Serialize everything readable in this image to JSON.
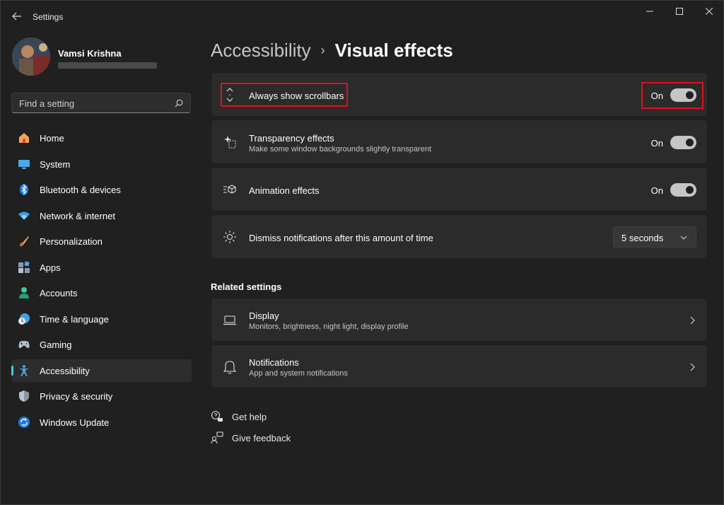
{
  "window": {
    "title": "Settings"
  },
  "profile": {
    "name": "Vamsi Krishna"
  },
  "search": {
    "placeholder": "Find a setting"
  },
  "sidebar": {
    "items": [
      {
        "label": "Home",
        "icon": "home-icon"
      },
      {
        "label": "System",
        "icon": "system-icon"
      },
      {
        "label": "Bluetooth & devices",
        "icon": "bluetooth-icon"
      },
      {
        "label": "Network & internet",
        "icon": "wifi-icon"
      },
      {
        "label": "Personalization",
        "icon": "brush-icon"
      },
      {
        "label": "Apps",
        "icon": "apps-icon"
      },
      {
        "label": "Accounts",
        "icon": "person-icon"
      },
      {
        "label": "Time & language",
        "icon": "globe-clock-icon"
      },
      {
        "label": "Gaming",
        "icon": "gamepad-icon"
      },
      {
        "label": "Accessibility",
        "icon": "accessibility-icon",
        "active": true
      },
      {
        "label": "Privacy & security",
        "icon": "shield-icon"
      },
      {
        "label": "Windows Update",
        "icon": "refresh-icon"
      }
    ]
  },
  "breadcrumb": {
    "parent": "Accessibility",
    "separator": "›",
    "current": "Visual effects"
  },
  "settings": {
    "scrollbars": {
      "title": "Always show scrollbars",
      "state_label": "On"
    },
    "transparency": {
      "title": "Transparency effects",
      "subtitle": "Make some window backgrounds slightly transparent",
      "state_label": "On"
    },
    "animation": {
      "title": "Animation effects",
      "state_label": "On"
    },
    "notifications_timeout": {
      "title": "Dismiss notifications after this amount of time",
      "value": "5 seconds"
    }
  },
  "related": {
    "title": "Related settings",
    "display": {
      "title": "Display",
      "subtitle": "Monitors, brightness, night light, display profile"
    },
    "notifications": {
      "title": "Notifications",
      "subtitle": "App and system notifications"
    }
  },
  "help": {
    "get_help": "Get help",
    "give_feedback": "Give feedback"
  },
  "colors": {
    "background": "#202020",
    "card": "#2b2b2b",
    "accent": "#4cc2ff",
    "highlight": "#e0101e"
  }
}
